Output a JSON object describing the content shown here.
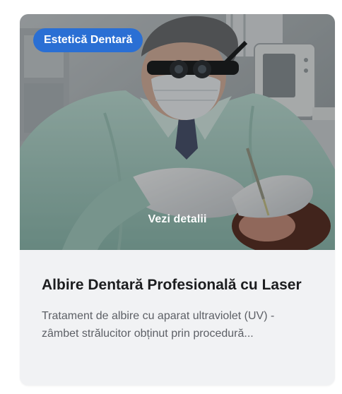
{
  "card": {
    "badge": "Estetică Dentară",
    "details_link": "Vezi detalii",
    "title": "Albire Dentară Profesională cu Laser",
    "description_line1": "Tratament de albire cu aparat ultraviolet (UV) -",
    "description_line2": "zâmbet strălucitor obținut prin procedură...",
    "image": {
      "subject": "dentist-photo"
    }
  },
  "colors": {
    "badge_bg": "#2a6fd4",
    "card_bg": "#f1f2f4",
    "title": "#1c1d1f",
    "description": "#5d6066"
  }
}
